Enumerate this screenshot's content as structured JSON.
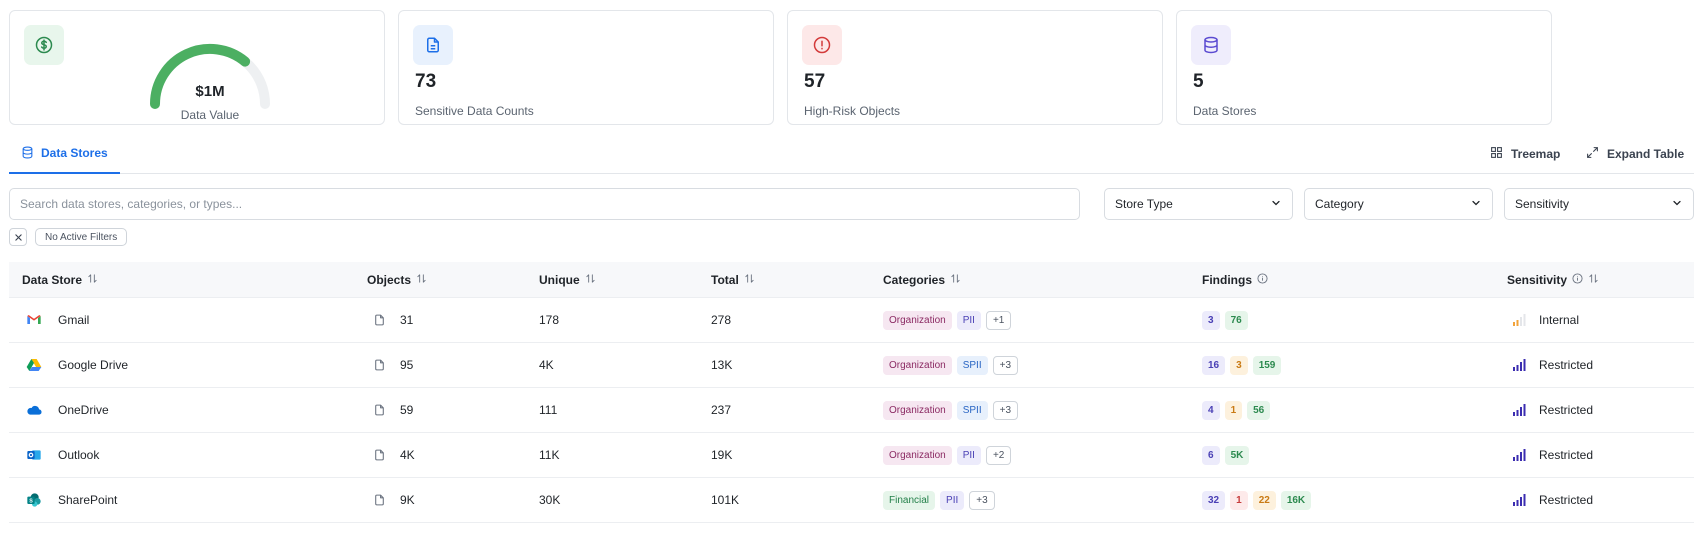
{
  "cards": [
    {
      "type": "gauge",
      "icon": "dollar-icon",
      "value": "$1M",
      "label": "Data Value",
      "fill_fraction": 0.72
    },
    {
      "type": "stat",
      "icon": "document-icon",
      "value": "73",
      "label": "Sensitive Data Counts"
    },
    {
      "type": "stat",
      "icon": "alert-icon",
      "value": "57",
      "label": "High-Risk Objects"
    },
    {
      "type": "stat",
      "icon": "database-icon",
      "value": "5",
      "label": "Data Stores"
    }
  ],
  "tabs": {
    "active": "Data Stores",
    "treemap": "Treemap",
    "expand": "Expand Table"
  },
  "search": {
    "placeholder": "Search data stores, categories, or types..."
  },
  "filters": {
    "store_type": "Store Type",
    "category": "Category",
    "sensitivity": "Sensitivity",
    "active_label": "No Active Filters"
  },
  "table": {
    "headers": [
      "Data Store",
      "Objects",
      "Unique",
      "Total",
      "Categories",
      "Findings",
      "Sensitivity"
    ],
    "rows": [
      {
        "store": "Gmail",
        "icon": "gmail-icon",
        "objects": "31",
        "unique": "178",
        "total": "278",
        "categories": [
          {
            "text": "Organization",
            "kind": "org"
          },
          {
            "text": "PII",
            "kind": "pii"
          },
          {
            "text": "+1",
            "kind": "more"
          }
        ],
        "findings": [
          {
            "text": "3",
            "kind": "purple"
          },
          {
            "text": "76",
            "kind": "green"
          }
        ],
        "sensitivity": "Internal",
        "sensitivity_level": 2
      },
      {
        "store": "Google Drive",
        "icon": "google-drive-icon",
        "objects": "95",
        "unique": "4K",
        "total": "13K",
        "categories": [
          {
            "text": "Organization",
            "kind": "org"
          },
          {
            "text": "SPII",
            "kind": "spii"
          },
          {
            "text": "+3",
            "kind": "more"
          }
        ],
        "findings": [
          {
            "text": "16",
            "kind": "purple"
          },
          {
            "text": "3",
            "kind": "orange"
          },
          {
            "text": "159",
            "kind": "green"
          }
        ],
        "sensitivity": "Restricted",
        "sensitivity_level": 4
      },
      {
        "store": "OneDrive",
        "icon": "onedrive-icon",
        "objects": "59",
        "unique": "111",
        "total": "237",
        "categories": [
          {
            "text": "Organization",
            "kind": "org"
          },
          {
            "text": "SPII",
            "kind": "spii"
          },
          {
            "text": "+3",
            "kind": "more"
          }
        ],
        "findings": [
          {
            "text": "4",
            "kind": "purple"
          },
          {
            "text": "1",
            "kind": "orange"
          },
          {
            "text": "56",
            "kind": "green"
          }
        ],
        "sensitivity": "Restricted",
        "sensitivity_level": 4
      },
      {
        "store": "Outlook",
        "icon": "outlook-icon",
        "objects": "4K",
        "unique": "11K",
        "total": "19K",
        "categories": [
          {
            "text": "Organization",
            "kind": "org"
          },
          {
            "text": "PII",
            "kind": "pii"
          },
          {
            "text": "+2",
            "kind": "more"
          }
        ],
        "findings": [
          {
            "text": "6",
            "kind": "purple"
          },
          {
            "text": "5K",
            "kind": "green"
          }
        ],
        "sensitivity": "Restricted",
        "sensitivity_level": 4
      },
      {
        "store": "SharePoint",
        "icon": "sharepoint-icon",
        "objects": "9K",
        "unique": "30K",
        "total": "101K",
        "categories": [
          {
            "text": "Financial",
            "kind": "fin"
          },
          {
            "text": "PII",
            "kind": "pii"
          },
          {
            "text": "+3",
            "kind": "more"
          }
        ],
        "findings": [
          {
            "text": "32",
            "kind": "purple"
          },
          {
            "text": "1",
            "kind": "red"
          },
          {
            "text": "22",
            "kind": "orange"
          },
          {
            "text": "16K",
            "kind": "green"
          }
        ],
        "sensitivity": "Restricted",
        "sensitivity_level": 4
      }
    ]
  },
  "colors": {
    "accent": "#1d6fe8",
    "gauge": "#4caf62",
    "gauge_track": "#eef0f2",
    "restricted": "#3b2db0",
    "internal": "#f2a33a"
  }
}
